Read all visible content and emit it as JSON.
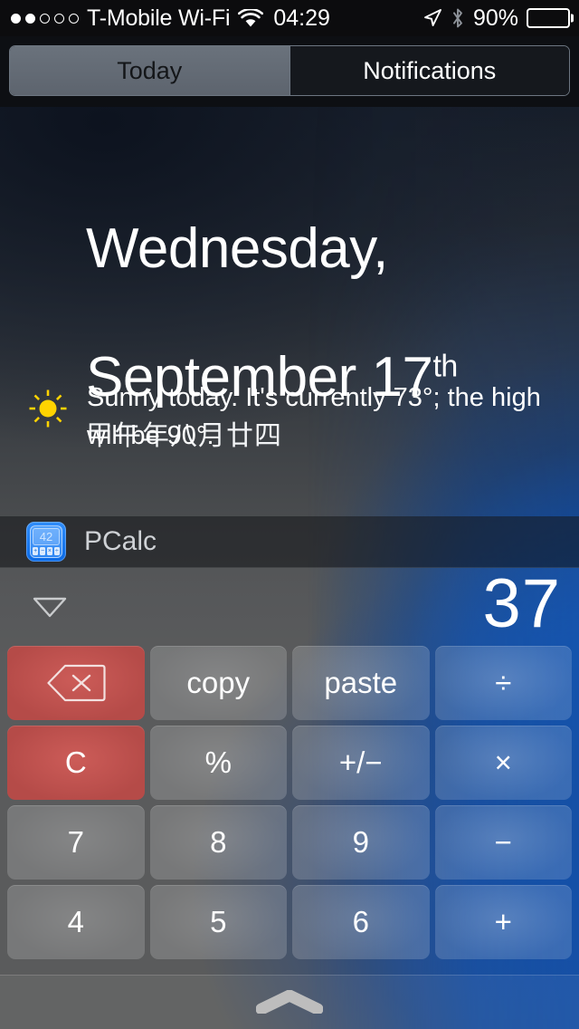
{
  "status_bar": {
    "signal_dots_total": 5,
    "signal_dots_filled": 2,
    "carrier": "T-Mobile Wi-Fi",
    "wifi_icon": "wifi-icon",
    "time": "04:29",
    "location_icon": "location-arrow-icon",
    "bluetooth_icon": "bluetooth-icon",
    "battery_percent": "90%",
    "battery_level": 90
  },
  "segmented_control": {
    "tabs": [
      {
        "label": "Today",
        "selected": true
      },
      {
        "label": "Notifications",
        "selected": false
      }
    ]
  },
  "today": {
    "date_line1": "Wednesday,",
    "date_line2": "September 17",
    "date_ordinal": "th",
    "lunar_date": "甲午年八月廿四",
    "weather": {
      "icon": "sun-icon",
      "summary": "Sunny today. It's currently 73°; the high will be 90°.",
      "current_temp": "73°",
      "high_temp": "90°",
      "condition": "Sunny"
    }
  },
  "pcalc": {
    "app_icon": "pcalc-app-icon",
    "icon_display_value": "42",
    "icon_keys": [
      "+",
      "−",
      "×",
      "÷"
    ],
    "title": "PCalc",
    "disclosure_icon": "disclosure-triangle-down-icon",
    "display_value": "37",
    "keypad_rows": [
      [
        {
          "label": "",
          "icon": "delete-backspace-icon",
          "style": "red"
        },
        {
          "label": "copy",
          "icon": "",
          "style": "gray"
        },
        {
          "label": "paste",
          "icon": "",
          "style": "gray"
        },
        {
          "label": "÷",
          "icon": "",
          "style": "op"
        }
      ],
      [
        {
          "label": "C",
          "icon": "",
          "style": "red"
        },
        {
          "label": "%",
          "icon": "",
          "style": "gray"
        },
        {
          "label": "+/−",
          "icon": "",
          "style": "gray"
        },
        {
          "label": "×",
          "icon": "",
          "style": "op"
        }
      ],
      [
        {
          "label": "7",
          "icon": "",
          "style": "gray"
        },
        {
          "label": "8",
          "icon": "",
          "style": "gray"
        },
        {
          "label": "9",
          "icon": "",
          "style": "gray"
        },
        {
          "label": "−",
          "icon": "",
          "style": "op"
        }
      ],
      [
        {
          "label": "4",
          "icon": "",
          "style": "gray"
        },
        {
          "label": "5",
          "icon": "",
          "style": "gray"
        },
        {
          "label": "6",
          "icon": "",
          "style": "gray"
        },
        {
          "label": "+",
          "icon": "",
          "style": "op"
        }
      ]
    ]
  },
  "bottom": {
    "grabber_icon": "notification-center-grabber-icon"
  },
  "colors": {
    "accent_blue": "#0d4cab",
    "key_red": "#c0504d",
    "sun_yellow": "#ffd400",
    "status_bar_bg": "#0c0c0e",
    "segment_selected_bg": "#636a74"
  }
}
